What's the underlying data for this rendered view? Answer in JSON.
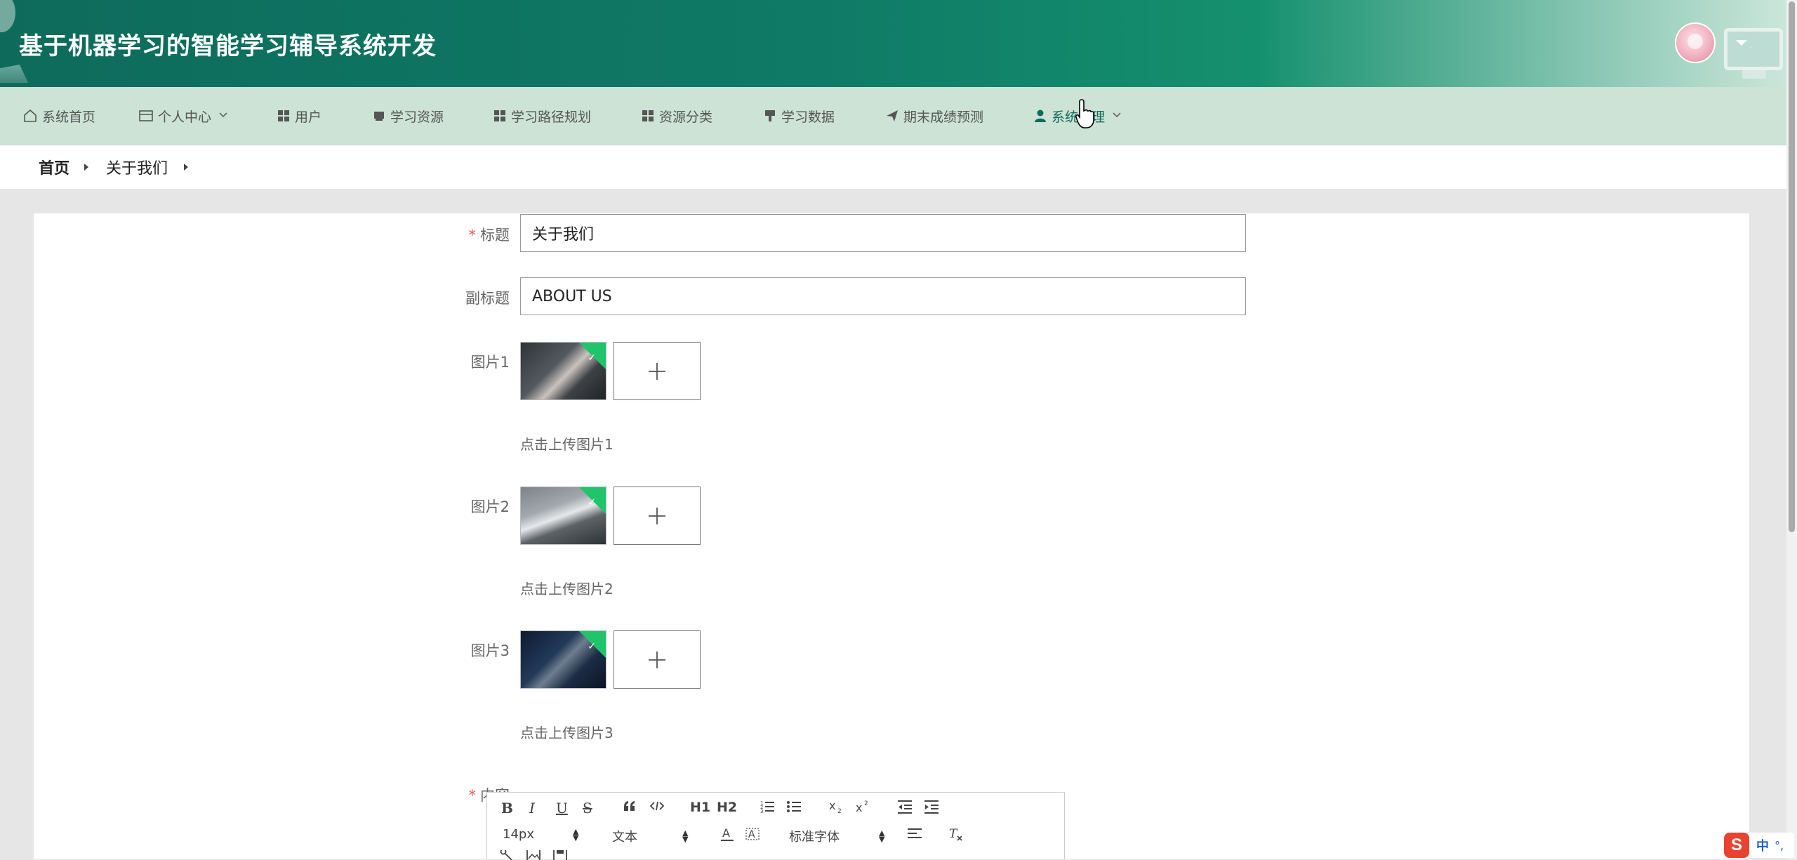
{
  "header": {
    "title": "基于机器学习的智能学习辅导系统开发"
  },
  "nav": {
    "items": [
      {
        "label": "系统首页",
        "icon": "home-icon"
      },
      {
        "label": "个人中心",
        "icon": "card-icon",
        "has_dropdown": true
      },
      {
        "label": "用户",
        "icon": "grid-icon"
      },
      {
        "label": "学习资源",
        "icon": "inbox-icon"
      },
      {
        "label": "学习路径规划",
        "icon": "grid-icon"
      },
      {
        "label": "资源分类",
        "icon": "grid-icon"
      },
      {
        "label": "学习数据",
        "icon": "brush-icon"
      },
      {
        "label": "期末成绩预测",
        "icon": "send-icon"
      },
      {
        "label": "系统管理",
        "icon": "user-icon",
        "has_dropdown": true
      }
    ]
  },
  "breadcrumb": {
    "home": "首页",
    "current": "关于我们"
  },
  "form": {
    "title": {
      "label": "标题",
      "required": "*",
      "value": "关于我们"
    },
    "subtitle": {
      "label": "副标题",
      "value": "ABOUT US"
    },
    "images": [
      {
        "label": "图片1",
        "hint": "点击上传图片1"
      },
      {
        "label": "图片2",
        "hint": "点击上传图片2"
      },
      {
        "label": "图片3",
        "hint": "点击上传图片3"
      }
    ],
    "content": {
      "label": "内容",
      "required": "*"
    }
  },
  "editor": {
    "font_size": "14px",
    "block_type": "文本",
    "font_family": "标准字体",
    "h1": "H1",
    "h2": "H2"
  },
  "ime": {
    "logo": "S",
    "mode": "中",
    "punct": "°,"
  },
  "colors": {
    "accent": "#0e6b5c",
    "badge": "#1fc46b",
    "required": "#e05a5a",
    "nav_bg": "#cde3d6"
  }
}
